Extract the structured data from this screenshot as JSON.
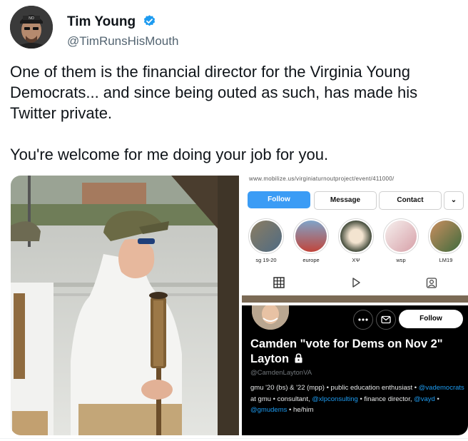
{
  "author": {
    "name": "Tim Young",
    "handle": "@TimRunsHisMouth",
    "avatar_icon": "avatar-photo",
    "verified_icon": "verified-badge-icon",
    "verified_color": "#1d9bf0"
  },
  "tweet": {
    "text": "One of them is the financial director for the Virginia Young\nDemocrats... and since being outed as such, has made his\nTwitter private.\n\nYou're welcome for me doing your job for you."
  },
  "media": {
    "instagram": {
      "url_fragment": "www.mobilize.us/virginiaturnoutproject/event/411000/",
      "follow_label": "Follow",
      "message_label": "Message",
      "contact_label": "Contact",
      "more_label": "⌄",
      "highlights": [
        {
          "label": "sg 19-20"
        },
        {
          "label": "europe"
        },
        {
          "label": "XΨ"
        },
        {
          "label": "wsp"
        },
        {
          "label": "LM19"
        }
      ],
      "accent_color": "#3b9cf5"
    },
    "twitter_profile": {
      "follow_label": "Follow",
      "display_name": "Camden \"vote for Dems on Nov 2\" Layton",
      "lock_icon": "lock-icon",
      "handle": "@CamdenLaytonVA",
      "bio_1": "gmu '20 (bs) & '22 (mpp) • public education enthusiast • ",
      "bio_link_1": "@vademocrats",
      "bio_2": " at gmu • consultant, ",
      "bio_link_2": "@xlpconsulting",
      "bio_3": " • finance director, ",
      "bio_link_3": "@vayd",
      "bio_4": " • ",
      "bio_link_4": "@gmudems",
      "bio_5": " • he/him",
      "link_color": "#1d9bf0"
    }
  }
}
